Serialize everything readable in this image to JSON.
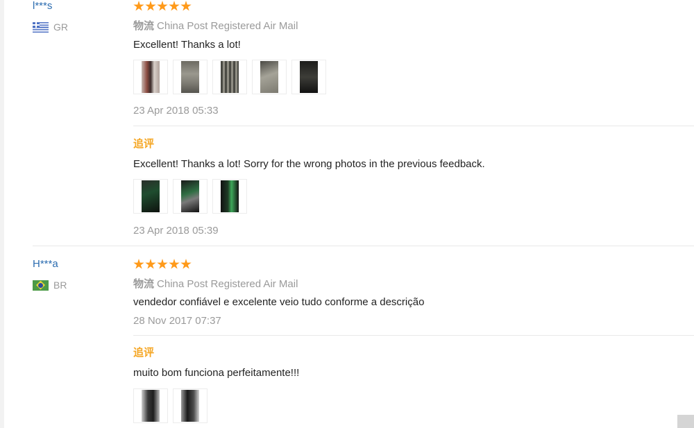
{
  "reviews": [
    {
      "user": "l***s",
      "country_code": "GR",
      "stars": 5,
      "logistics_cn": "物流",
      "logistics": "China Post Registered Air Mail",
      "text": "Excellent! Thanks a lot!",
      "photos": [
        "photo-1",
        "photo-2",
        "photo-3",
        "photo-4",
        "photo-5"
      ],
      "date": "23 Apr 2018 05:33",
      "append": {
        "label": "追评",
        "text": "Excellent! Thanks a lot! Sorry for the wrong photos in the previous feedback.",
        "photos": [
          "photo-1",
          "photo-2",
          "photo-3"
        ],
        "date": "23 Apr 2018 05:39"
      }
    },
    {
      "user": "H***a",
      "country_code": "BR",
      "stars": 5,
      "logistics_cn": "物流",
      "logistics": "China Post Registered Air Mail",
      "text": "vendedor confiável e excelente veio tudo conforme a descrição",
      "date": "28 Nov 2017 07:37",
      "append": {
        "label": "追评",
        "text": "muito bom funciona perfeitamente!!!",
        "photos": [
          "photo-1",
          "photo-2"
        ]
      }
    }
  ],
  "colors": {
    "username": "#2b6cb0",
    "star": "#ff9a1a",
    "append_label": "#f5a623",
    "muted": "#9a9a9a"
  },
  "icons": {
    "star": "star-icon",
    "flag_gr": "greece-flag-icon",
    "flag_br": "brazil-flag-icon"
  }
}
